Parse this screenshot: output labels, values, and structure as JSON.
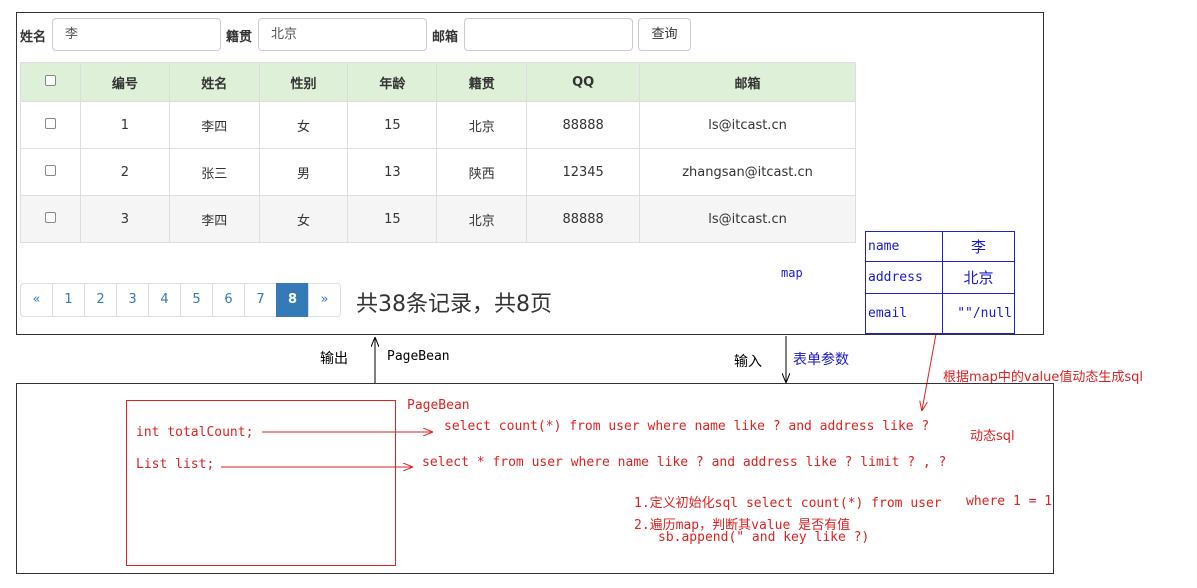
{
  "search": {
    "name_label": "姓名",
    "name_value": "李",
    "origin_label": "籍贯",
    "origin_value": "北京",
    "email_label": "邮箱",
    "email_value": "",
    "query_button": "查询"
  },
  "table": {
    "headers": [
      "编号",
      "姓名",
      "性别",
      "年龄",
      "籍贯",
      "QQ",
      "邮箱"
    ],
    "rows": [
      [
        "1",
        "李四",
        "女",
        "15",
        "北京",
        "88888",
        "ls@itcast.cn"
      ],
      [
        "2",
        "张三",
        "男",
        "13",
        "陕西",
        "12345",
        "zhangsan@itcast.cn"
      ],
      [
        "3",
        "李四",
        "女",
        "15",
        "北京",
        "88888",
        "ls@itcast.cn"
      ]
    ]
  },
  "pagination": {
    "prev": "«",
    "pages": [
      "1",
      "2",
      "3",
      "4",
      "5",
      "6",
      "7",
      "8"
    ],
    "active_page": "8",
    "next": "»",
    "summary": "共38条记录，共8页"
  },
  "map": {
    "label": "map",
    "rows": [
      {
        "key": "name",
        "value": "李"
      },
      {
        "key": "address",
        "value": "北京"
      },
      {
        "key": "email",
        "value": "\"\"/null"
      }
    ]
  },
  "flow": {
    "output_label": "输出",
    "pagebean_label": "PageBean",
    "input_label": "输入",
    "form_params_label": "表单参数",
    "map_note": "根据map中的value值动态生成sql"
  },
  "pagebean": {
    "title": "PageBean",
    "field_total": "int totalCount;",
    "field_list": "List list;"
  },
  "sql": {
    "count_query": "select count(*) from user where name like ? and address like ?",
    "list_query": "select * from user where name like ? and address like ? limit ? , ?",
    "dynamic_label": "动态sql",
    "step1": "1.定义初始化sql select count(*) from user",
    "step1_where": "where 1 = 1",
    "step2": "2.遍历map，判断其value 是否有值",
    "step2_code": "sb.append(\" and  key like ?)"
  },
  "colors": {
    "table_header_bg": "#dff0d8",
    "pager_active": "#337ab7",
    "annotation_red": "#d22222",
    "annotation_blue": "#1a1ac8"
  }
}
